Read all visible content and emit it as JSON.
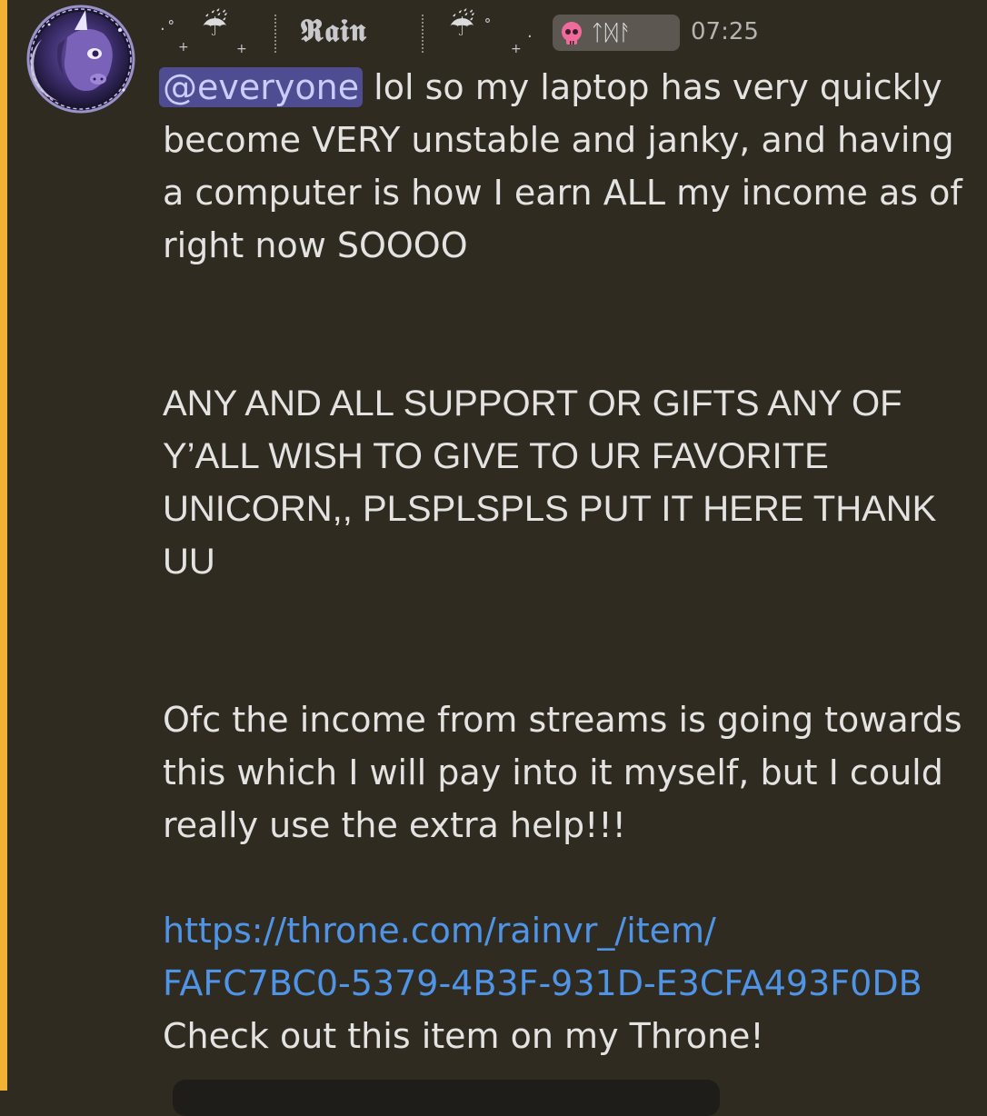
{
  "colors": {
    "background": "#2f2b21",
    "mention_bar": "#f0b232",
    "mention_bg": "#4e4d91",
    "link": "#4f94e6",
    "text": "#e4e3e2",
    "timestamp": "#b5b4b1"
  },
  "author": {
    "avatar_icon": "purple-unicorn-avatar-icon",
    "deco_left": "☔",
    "deco_right": "☔",
    "display_name": "𝕽𝖆𝖎𝖓",
    "tag_icon": "pink-skull-icon",
    "tag_text": "ᛏᛞᚨ",
    "timestamp": "07:25"
  },
  "message": {
    "mention": "@everyone",
    "line1_rest": " lol so my laptop has very quickly become VERY unstable and janky, and having a computer is how I earn ALL my income as of right now SOOOO",
    "caps_paragraph": "ANY AND ALL SUPPORT OR GIFTS ANY OF Y’ALL WISH TO GIVE TO UR FAVORITE UNICORN,, PLSPLSPLS PUT IT HERE THANK UU",
    "paragraph3": "Ofc the income from streams is going towards this which I will pay into it myself, but I could really use the extra help!!!",
    "link_line1": "https://throne.com/rainvr_/item/",
    "link_line2": "FAFC7BC0-5379-4B3F-931D-E3CFA493F0DB",
    "embed_caption": "Check out this item on my Throne!"
  }
}
